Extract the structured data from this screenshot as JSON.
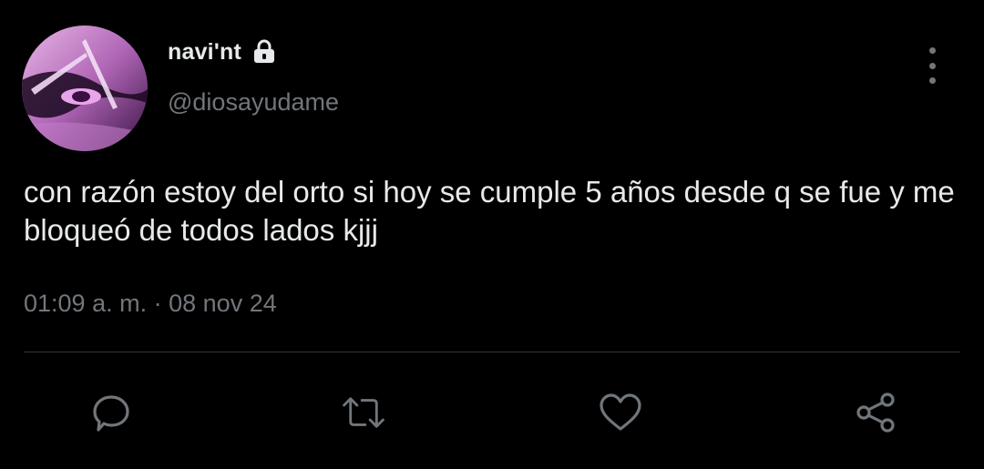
{
  "tweet": {
    "display_name": "navi'nt",
    "handle": "@diosayudame",
    "text": "con razón estoy del orto si hoy se cumple 5 años desde q se fue y me bloqueó de todos lados kjjj",
    "time": "01:09 a. m.",
    "separator": "·",
    "date": "08 nov 24",
    "protected": true
  },
  "icons": {
    "lock": "lock-icon",
    "more": "more-vertical-icon",
    "reply": "reply-icon",
    "retweet": "retweet-icon",
    "like": "heart-icon",
    "share": "share-icon"
  },
  "colors": {
    "background": "#000000",
    "text_primary": "#e7e9ea",
    "text_secondary": "#71767b",
    "divider": "#2f3336"
  }
}
